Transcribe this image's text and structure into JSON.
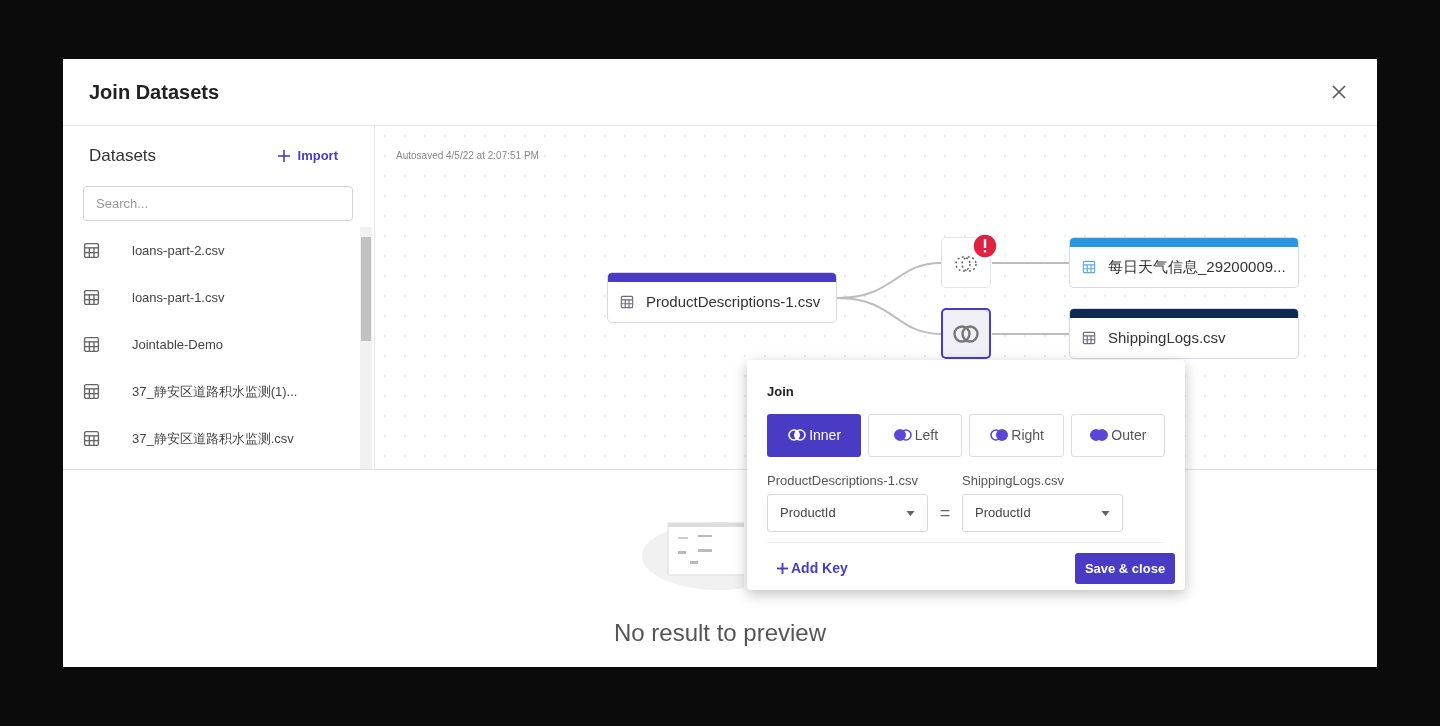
{
  "dialog": {
    "title": "Join Datasets"
  },
  "datasets": {
    "title": "Datasets",
    "import_label": "Import",
    "search_placeholder": "Search...",
    "items": [
      {
        "name": "loans-part-2.csv"
      },
      {
        "name": "loans-part-1.csv"
      },
      {
        "name": "Jointable-Demo"
      },
      {
        "name": "37_静安区道路积水监测(1)..."
      },
      {
        "name": "37_静安区道路积水监测.csv"
      }
    ]
  },
  "canvas": {
    "autosave": "Autosaved 4/5/22 at 2:07:51 PM",
    "base_node": {
      "name": "ProductDescriptions-1.csv",
      "color": "#4a3bc4"
    },
    "branches": [
      {
        "join": {
          "kind": "error",
          "selected": false
        },
        "node": {
          "name": "每日天气信息_29200009...",
          "color": "#2b96e0"
        }
      },
      {
        "join": {
          "kind": "join",
          "selected": true
        },
        "node": {
          "name": "ShippingLogs.csv",
          "color": "#0e2a50"
        }
      }
    ]
  },
  "join_popover": {
    "title": "Join",
    "types": [
      {
        "kind": "inner",
        "label": "Inner",
        "selected": true
      },
      {
        "kind": "left",
        "label": "Left",
        "selected": false
      },
      {
        "kind": "right",
        "label": "Right",
        "selected": false
      },
      {
        "kind": "outer",
        "label": "Outer",
        "selected": false
      }
    ],
    "left_source": "ProductDescriptions-1.csv",
    "right_source": "ShippingLogs.csv",
    "left_key": "ProductId",
    "equals": "=",
    "right_key": "ProductId",
    "add_key": "Add Key",
    "save": "Save & close"
  },
  "preview": {
    "message": "No result to preview"
  }
}
